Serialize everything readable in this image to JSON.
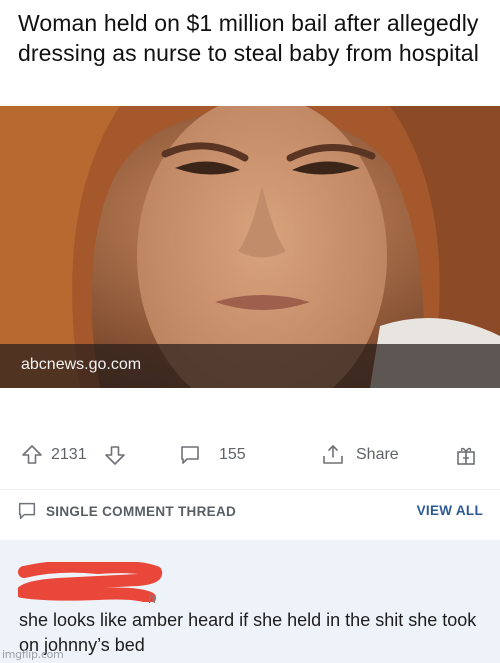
{
  "article": {
    "headline": "Woman held on $1 million bail after allegedly dressing as nurse to steal baby from hospital",
    "domain": "abcnews.go.com"
  },
  "actions": {
    "upvote_count": "2131",
    "comment_count": "155",
    "share_label": "Share"
  },
  "thread": {
    "label": "SINGLE COMMENT THREAD",
    "view_all_label": "VIEW ALL"
  },
  "comment": {
    "username_suffix": "h",
    "body": "she looks like amber heard if she held in the shit she took on johnny’s bed"
  },
  "watermark": "imgflip.com",
  "colors": {
    "link_blue": "#2d5a93",
    "comment_bg": "#eef3f9",
    "redaction_red": "#e8473a",
    "icon_gray": "#6e7176"
  }
}
